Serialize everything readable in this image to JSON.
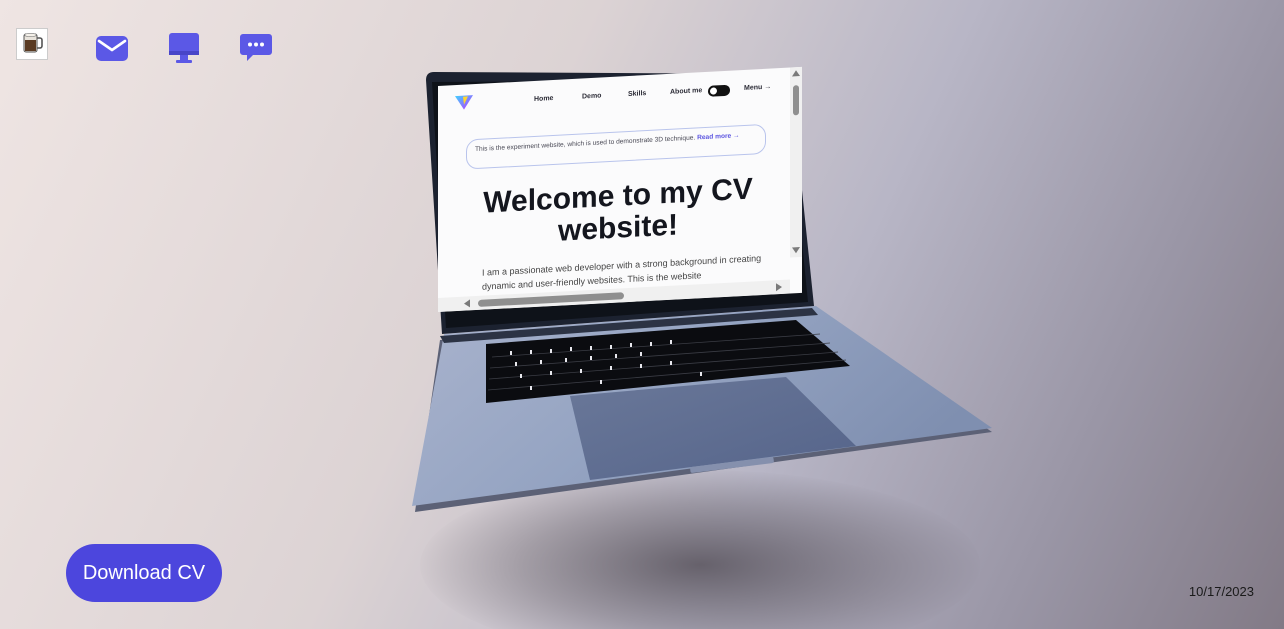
{
  "top_nav": {
    "avatar_icon": "coffee-mug-avatar-icon",
    "items": [
      {
        "name": "mail",
        "icon": "envelope-icon"
      },
      {
        "name": "desktop",
        "icon": "monitor-icon"
      },
      {
        "name": "chat",
        "icon": "chat-bubble-icon"
      }
    ],
    "accent_color": "#5b58e6"
  },
  "laptop_screen": {
    "nav": {
      "home": "Home",
      "demo": "Demo",
      "skills": "Skills",
      "about": "About me",
      "menu": "Menu →"
    },
    "banner": {
      "text": "This is the experiment website, which is used to demonstrate 3D technique.",
      "link": "Read more →"
    },
    "title": "Welcome to my CV website!",
    "description": "I am a passionate web developer with a strong background in creating dynamic and user-friendly websites. This is the website"
  },
  "download_button": {
    "label": "Download CV",
    "color": "#4c46dd"
  },
  "date": "10/17/2023"
}
